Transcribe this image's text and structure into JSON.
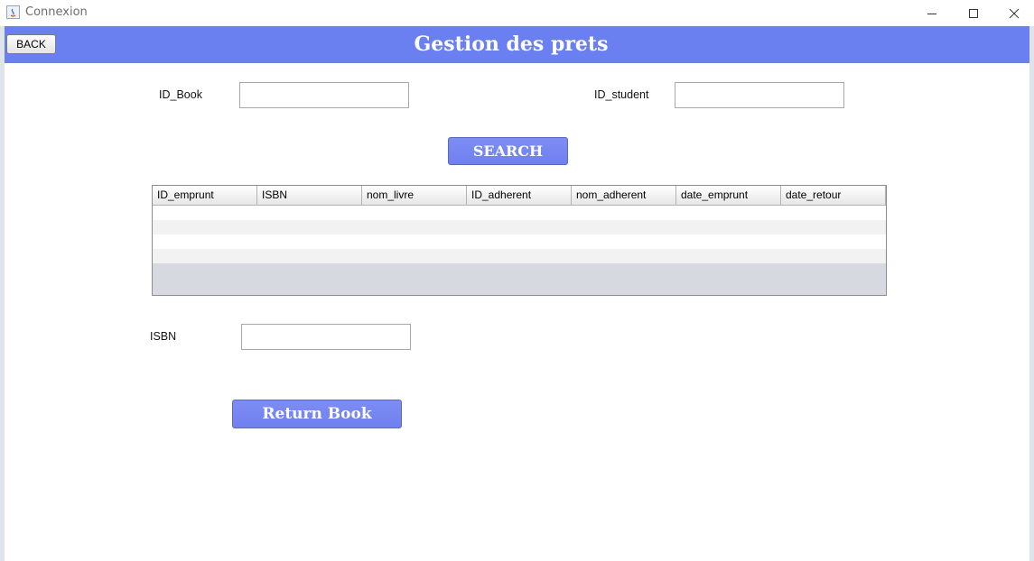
{
  "window": {
    "title": "Connexion",
    "controls": {
      "minimize": "minimize-icon",
      "maximize": "maximize-icon",
      "close": "close-icon"
    }
  },
  "header": {
    "back_label": "BACK",
    "title": "Gestion des prets",
    "color": "#6b80f0"
  },
  "form": {
    "id_book_label": "ID_Book",
    "id_book_value": "",
    "id_student_label": "ID_student",
    "id_student_value": "",
    "search_label": "SEARCH"
  },
  "table": {
    "columns": [
      "ID_emprunt",
      "ISBN",
      "nom_livre",
      "ID_adherent",
      "nom_adherent",
      "date_emprunt",
      "date_retour"
    ],
    "rows": [
      [
        "",
        "",
        "",
        "",
        "",
        "",
        ""
      ],
      [
        "",
        "",
        "",
        "",
        "",
        "",
        ""
      ],
      [
        "",
        "",
        "",
        "",
        "",
        "",
        ""
      ],
      [
        "",
        "",
        "",
        "",
        "",
        "",
        ""
      ]
    ]
  },
  "return": {
    "isbn_label": "ISBN",
    "isbn_value": "",
    "return_label": "Return Book"
  }
}
